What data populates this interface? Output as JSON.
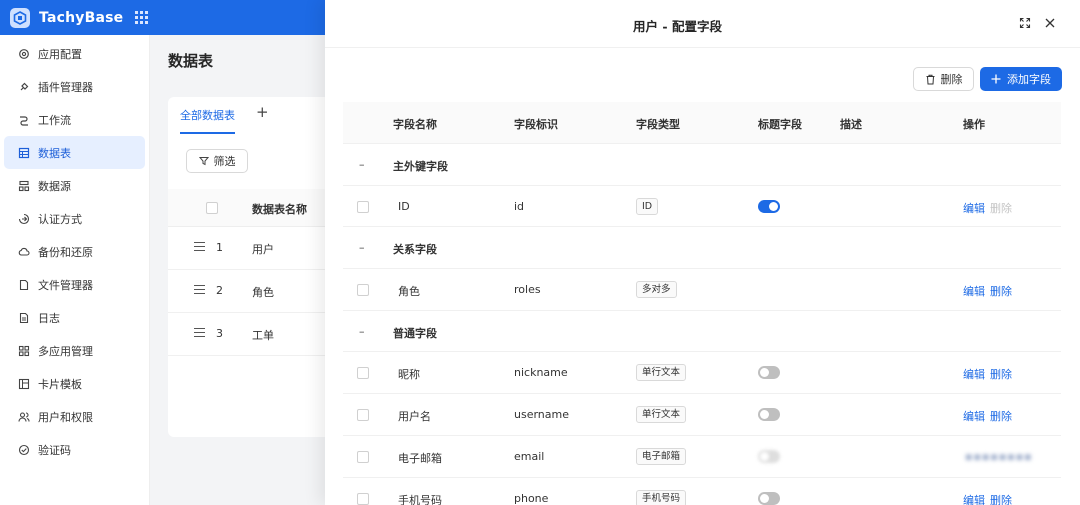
{
  "app": {
    "brand": "TachyBase"
  },
  "sidebar": {
    "items": [
      {
        "label": "应用配置",
        "icon": "gear-icon"
      },
      {
        "label": "插件管理器",
        "icon": "plug-icon"
      },
      {
        "label": "工作流",
        "icon": "workflow-icon"
      },
      {
        "label": "数据表",
        "icon": "table-icon",
        "active": true
      },
      {
        "label": "数据源",
        "icon": "database-icon"
      },
      {
        "label": "认证方式",
        "icon": "login-icon"
      },
      {
        "label": "备份和还原",
        "icon": "cloud-icon"
      },
      {
        "label": "文件管理器",
        "icon": "file-icon"
      },
      {
        "label": "日志",
        "icon": "log-icon"
      },
      {
        "label": "多应用管理",
        "icon": "apps-grid-icon"
      },
      {
        "label": "卡片模板",
        "icon": "card-icon"
      },
      {
        "label": "用户和权限",
        "icon": "users-icon"
      },
      {
        "label": "验证码",
        "icon": "check-circle-icon"
      }
    ]
  },
  "background_page": {
    "title": "数据表",
    "tab_label": "全部数据表",
    "add_tab": "+",
    "filter_label": "筛选",
    "column_name": "数据表名称",
    "rows": [
      {
        "num": "1",
        "name": "用户"
      },
      {
        "num": "2",
        "name": "角色"
      },
      {
        "num": "3",
        "name": "工单"
      }
    ]
  },
  "drawer": {
    "title": "用户 - 配置字段",
    "delete_label": "删除",
    "add_field_label": "添加字段",
    "columns": {
      "name": "字段名称",
      "key": "字段标识",
      "type": "字段类型",
      "title_field": "标题字段",
      "description": "描述",
      "actions": "操作"
    },
    "edit_label": "编辑",
    "remove_label": "删除",
    "groups": {
      "primary": "主外键字段",
      "relation": "关系字段",
      "normal": "普通字段"
    },
    "collapse_symbol": "–",
    "fields": {
      "id": {
        "name": "ID",
        "key": "id",
        "type": "ID",
        "title_field": true
      },
      "roles": {
        "name": "角色",
        "key": "roles",
        "type": "多对多"
      },
      "nickname": {
        "name": "昵称",
        "key": "nickname",
        "type": "单行文本",
        "title_field": false
      },
      "username": {
        "name": "用户名",
        "key": "username",
        "type": "单行文本",
        "title_field": false
      },
      "email": {
        "name": "电子邮箱",
        "key": "email",
        "type": "电子邮箱",
        "title_field": false
      },
      "phone": {
        "name": "手机号码",
        "key": "phone",
        "type": "手机号码",
        "title_field": false
      }
    }
  },
  "colors": {
    "primary": "#1d6ae5",
    "active_nav_bg": "#e6efff",
    "disabled_text": "#c4c4c4"
  }
}
